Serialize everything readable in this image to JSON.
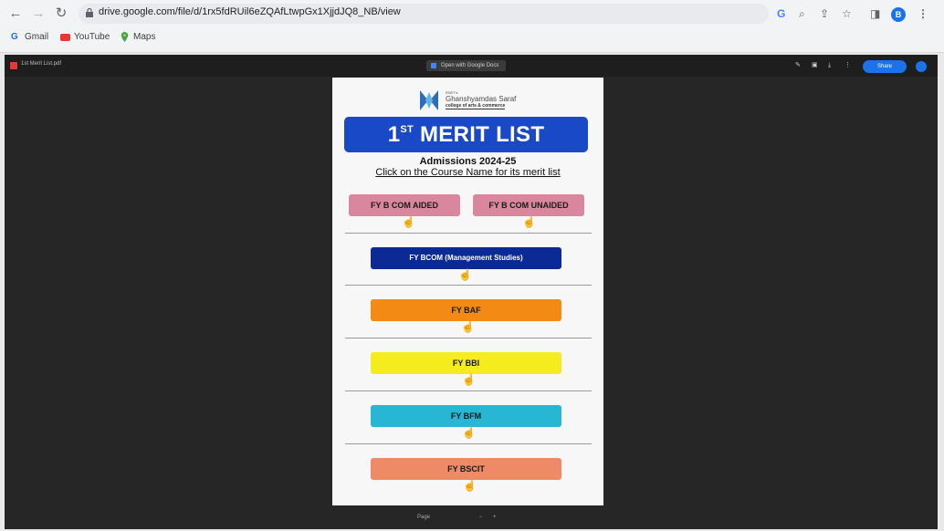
{
  "browser": {
    "url": "drive.google.com/file/d/1rx5fdRUil6eZQAfLtwpGx1XjjdJQ8_NB/view",
    "bookmarks": [
      {
        "label": "Gmail",
        "color": "#1a73e8"
      },
      {
        "label": "YouTube",
        "color": "#e53935"
      },
      {
        "label": "Maps",
        "color": "#34a853"
      }
    ],
    "avatar_letter": "B"
  },
  "viewer": {
    "file_name": "1st Merit List.pdf",
    "open_with": "Open with Google Docs",
    "share_label": "Share",
    "page_label": "Page"
  },
  "document": {
    "college_prefix": "RSET's",
    "college_name": "Ghanshyamdas Saraf",
    "college_sub": "college of arts & commerce",
    "title_number": "1",
    "title_suffix": "ST",
    "title_text": "MERIT LIST",
    "admissions": "Admissions 2024-25",
    "instruction": "Click on the Course Name for its merit list",
    "courses": [
      {
        "label": "FY B COM AIDED",
        "color": "#d9869f"
      },
      {
        "label": "FY B COM UNAIDED",
        "color": "#d9869f"
      },
      {
        "label": "FY BCOM (Management Studies)",
        "color": "#0b2a96"
      },
      {
        "label": "FY BAF",
        "color": "#f28a14"
      },
      {
        "label": "FY BBI",
        "color": "#f4ec1c"
      },
      {
        "label": "FY BFM",
        "color": "#27b6d4"
      },
      {
        "label": "FY BSCIT",
        "color": "#ef8a66"
      }
    ]
  }
}
